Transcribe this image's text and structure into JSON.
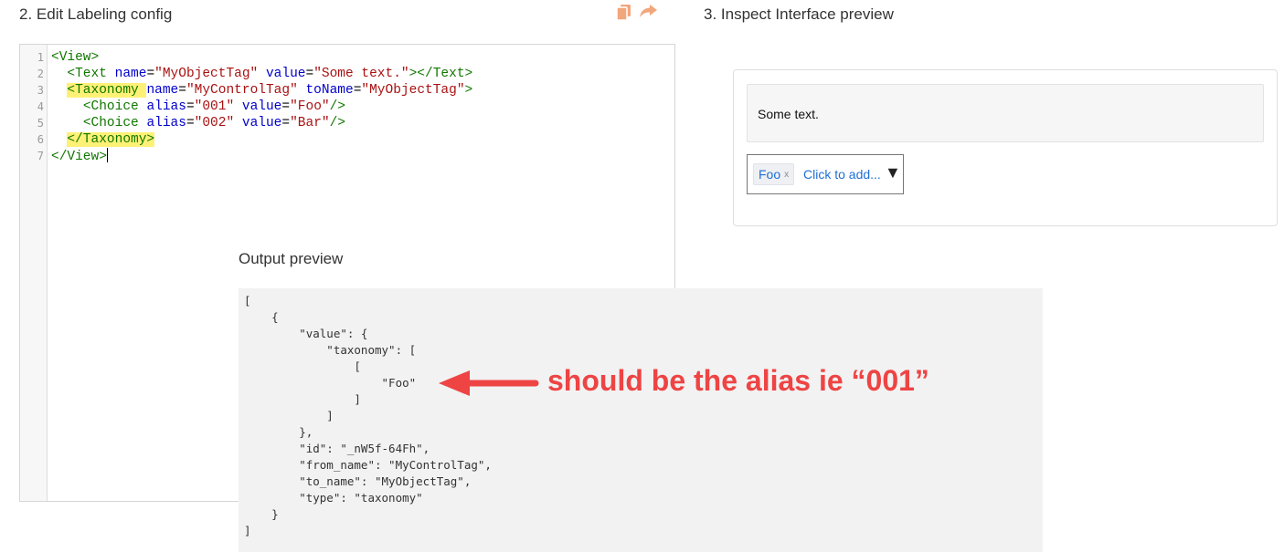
{
  "editor_section": {
    "title": "2. Edit Labeling config",
    "copy_icon": "copy-icon",
    "share_icon": "share-icon",
    "line_numbers": [
      "1",
      "2",
      "3",
      "4",
      "5",
      "6",
      "7"
    ],
    "code": {
      "l1_tag": "<View>",
      "l2_open": "<Text",
      "l2_attr1": "name",
      "l2_eq1": "=",
      "l2_val1": "\"MyObjectTag\"",
      "l2_attr2": "value",
      "l2_eq2": "=",
      "l2_val2": "\"Some text.\"",
      "l2_close": "></Text>",
      "l3_open": "<Taxonomy",
      "l3_attr1": "name",
      "l3_eq1": "=",
      "l3_val1": "\"MyControlTag\"",
      "l3_attr2": "toName",
      "l3_eq2": "=",
      "l3_val2": "\"MyObjectTag\"",
      "l3_close": ">",
      "l4_open": "<Choice",
      "l4_attr1": "alias",
      "l4_eq1": "=",
      "l4_val1": "\"001\"",
      "l4_attr2": "value",
      "l4_eq2": "=",
      "l4_val2": "\"Foo\"",
      "l4_close": "/>",
      "l5_open": "<Choice",
      "l5_attr1": "alias",
      "l5_eq1": "=",
      "l5_val1": "\"002\"",
      "l5_attr2": "value",
      "l5_eq2": "=",
      "l5_val2": "\"Bar\"",
      "l5_close": "/>",
      "l6_tag": "</Taxonomy>",
      "l7_tag": "</View>"
    }
  },
  "interface_section": {
    "title": "3. Inspect Interface preview",
    "text_content": "Some text.",
    "selected_chip": "Foo",
    "chip_remove": "x",
    "add_prompt": "Click to add...",
    "dropdown_arrow": "▼"
  },
  "output_section": {
    "title": "Output preview",
    "lines": [
      "[",
      "    {",
      "        \"value\": {",
      "            \"taxonomy\": [",
      "                [",
      "                    \"Foo\"",
      "                ]",
      "            ]",
      "        },",
      "        \"id\": \"_nW5f-64Fh\",",
      "        \"from_name\": \"MyControlTag\",",
      "        \"to_name\": \"MyObjectTag\",",
      "        \"type\": \"taxonomy\"",
      "    }",
      "]"
    ]
  },
  "annotation": {
    "text": "should be the alias ie “001”",
    "color": "#ee4444"
  }
}
